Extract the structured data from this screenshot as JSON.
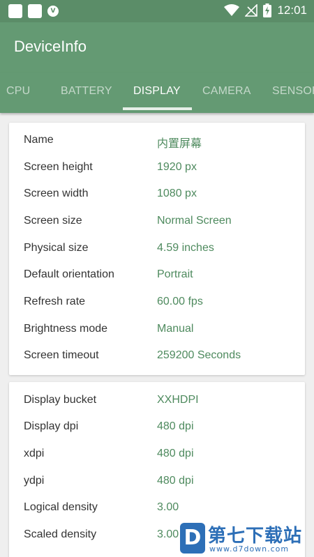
{
  "status_bar": {
    "time": "12:01",
    "left_icons": [
      "notification-square-icon",
      "notification-square-icon",
      "shield-icon"
    ],
    "right_icons": [
      "wifi-icon",
      "no-signal-icon",
      "battery-charging-icon"
    ]
  },
  "app_bar": {
    "title": "DeviceInfo"
  },
  "tabs": [
    {
      "label": "CPU"
    },
    {
      "label": "BATTERY"
    },
    {
      "label": "DISPLAY",
      "active": true
    },
    {
      "label": "CAMERA"
    },
    {
      "label": "SENSORS"
    }
  ],
  "display_card": {
    "rows": [
      {
        "label": "Name",
        "value": "内置屏幕"
      },
      {
        "label": "Screen height",
        "value": "1920 px"
      },
      {
        "label": "Screen width",
        "value": "1080 px"
      },
      {
        "label": "Screen size",
        "value": "Normal Screen"
      },
      {
        "label": "Physical size",
        "value": "4.59 inches"
      },
      {
        "label": "Default orientation",
        "value": "Portrait"
      },
      {
        "label": "Refresh rate",
        "value": "60.00 fps"
      },
      {
        "label": "Brightness mode",
        "value": "Manual"
      },
      {
        "label": "Screen timeout",
        "value": "259200 Seconds"
      }
    ]
  },
  "density_card": {
    "rows": [
      {
        "label": "Display bucket",
        "value": "XXHDPI"
      },
      {
        "label": "Display dpi",
        "value": "480 dpi"
      },
      {
        "label": "xdpi",
        "value": "480 dpi"
      },
      {
        "label": "ydpi",
        "value": "480 dpi"
      },
      {
        "label": "Logical density",
        "value": "3.00"
      },
      {
        "label": "Scaled density",
        "value": "3.00"
      }
    ]
  },
  "watermark": {
    "text": "第七下载站",
    "url": "www.d7down.com",
    "logo": "D"
  },
  "colors": {
    "status_bar": "#5b8d68",
    "app_bar": "#649a73",
    "value_text": "#4e8a5e",
    "background": "#efefef"
  }
}
